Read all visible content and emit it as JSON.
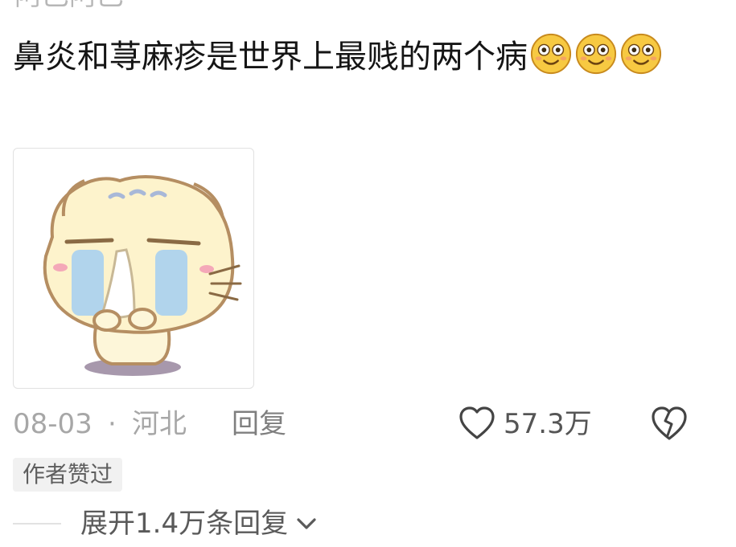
{
  "comment": {
    "username": "阿巴阿巴",
    "text": "鼻炎和荨麻疹是世界上最贱的两个病",
    "emojis": [
      "smiling-face-icon",
      "smiling-face-icon",
      "smiling-face-icon"
    ]
  },
  "meta": {
    "date": "08-03",
    "separator": "·",
    "location": "河北",
    "reply_label": "回复",
    "like_count": "57.3万"
  },
  "badge": "作者赞过",
  "expand": {
    "label": "展开1.4万条回复"
  },
  "colors": {
    "muted_text": "#a7a7a7",
    "emoji_yellow": "#f7c942",
    "badge_bg": "#f1f1f1"
  }
}
